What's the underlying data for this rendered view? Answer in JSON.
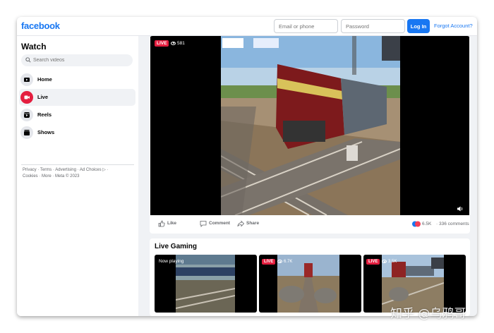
{
  "header": {
    "logo": "facebook",
    "email_placeholder": "Email or phone",
    "password_placeholder": "Password",
    "login_label": "Log In",
    "forgot_label": "Forgot Account?"
  },
  "sidebar": {
    "title": "Watch",
    "search_placeholder": "Search videos",
    "items": [
      {
        "label": "Home",
        "icon": "home-icon"
      },
      {
        "label": "Live",
        "icon": "live-icon",
        "active": true
      },
      {
        "label": "Reels",
        "icon": "reels-icon"
      },
      {
        "label": "Shows",
        "icon": "shows-icon"
      }
    ],
    "footer_line1": "Privacy · Terms · Advertising · Ad Choices ▷ ·",
    "footer_line2": "Cookies · More · Meta © 2023"
  },
  "video": {
    "live_badge": "LIVE",
    "viewers": "581",
    "actions": [
      "Like",
      "Comment",
      "Share"
    ],
    "reaction_count": "6.5K",
    "comment_count": "· 336 comments"
  },
  "gaming": {
    "title": "Live Gaming",
    "thumbs": [
      {
        "status": "Now playing"
      },
      {
        "live": "LIVE",
        "viewers": "6.7K"
      },
      {
        "live": "LIVE",
        "viewers": "3.5K"
      }
    ]
  },
  "colors": {
    "brand": "#1877f2",
    "live": "#e41e3f",
    "background": "#f0f2f5"
  },
  "watermark": "知乎 @乌鸦哥"
}
